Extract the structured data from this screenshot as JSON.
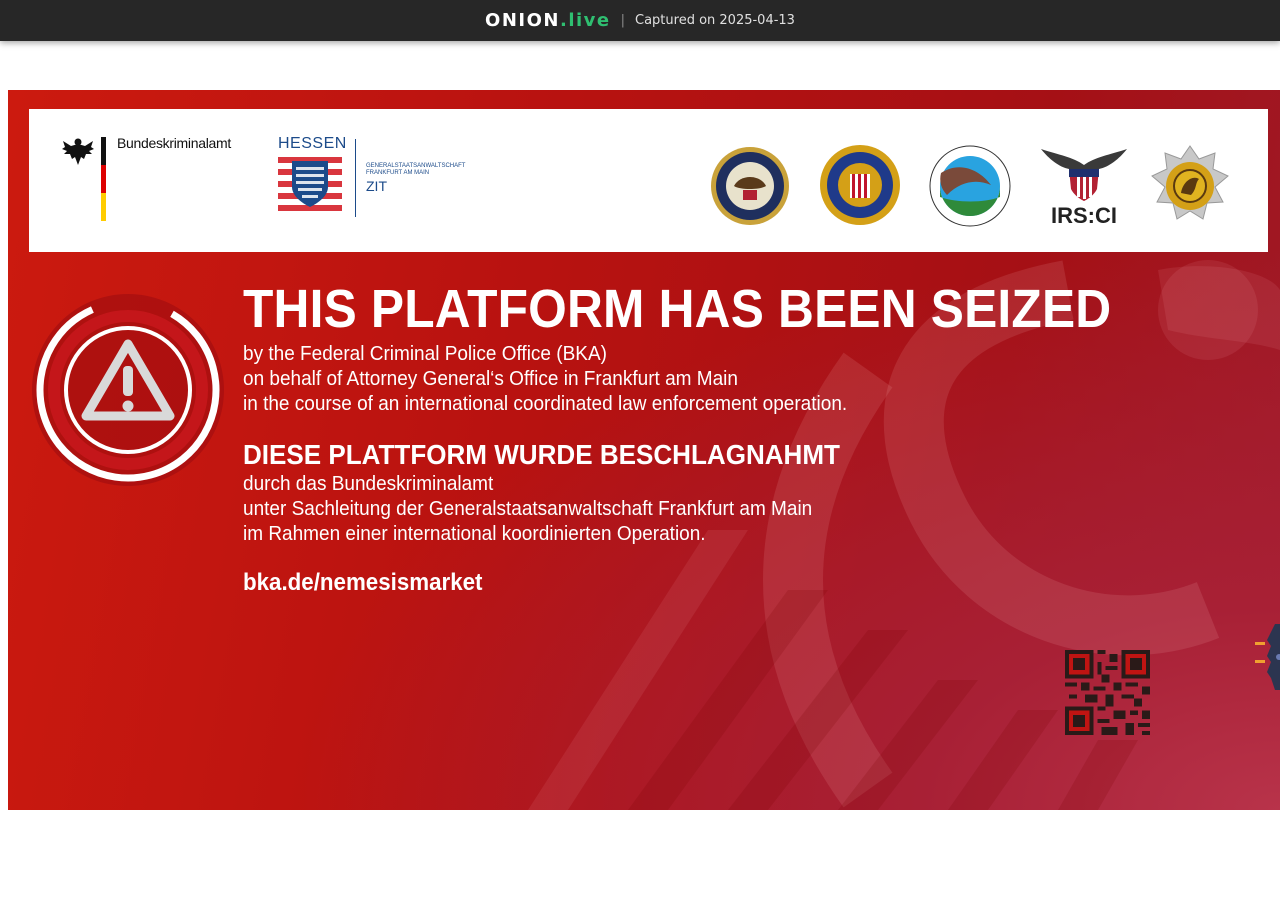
{
  "header": {
    "brand_main": "ONION",
    "brand_tld": ".live",
    "separator": "|",
    "captured": "Captured on 2025-04-13"
  },
  "logos": {
    "bka": "Bundeskriminalamt",
    "hessen": "HESSEN",
    "gsa_line1": "GENERALSTAATSANWALTSCHAFT",
    "gsa_line2": "FRANKFURT AM MAIN",
    "zit": "ZIT",
    "irs": "IRS:CI"
  },
  "seizure": {
    "title_en": "THIS PLATFORM HAS BEEN SEIZED",
    "en_line1": "by the Federal Criminal Police Office (BKA)",
    "en_line2": "on behalf of Attorney General‘s Office in Frankfurt am Main",
    "en_line3": "in the course of an international coordinated law enforcement operation.",
    "title_de": "DIESE PLATTFORM WURDE BESCHLAGNAHMT",
    "de_line1": "durch das Bundeskriminalamt",
    "de_line2": "unter Sachleitung der Generalstaatsanwaltschaft Frankfurt am Main",
    "de_line3": "im Rahmen einer international koordinierten Operation.",
    "link": "bka.de/nemesismarket"
  },
  "colors": {
    "topbar": "#272727",
    "brand_tld": "#2fbf71",
    "banner_red": "#c0140f",
    "hessen_blue": "#1c4b8a"
  },
  "icons": [
    "warning-icon",
    "federal-eagle-icon",
    "doj-seal",
    "fbi-seal",
    "dea-seal",
    "irs-ci-logo",
    "lithuania-police-seal",
    "qr-code"
  ]
}
